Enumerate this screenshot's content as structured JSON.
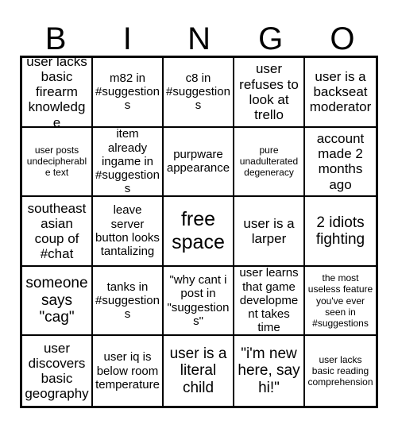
{
  "card": {
    "title_letters": [
      "B",
      "I",
      "N",
      "G",
      "O"
    ],
    "columns": 5,
    "rows": 5,
    "free_space_index": 12,
    "colors": {
      "background": "#ffffff",
      "text": "#000000",
      "grid_line": "#000000"
    },
    "cells": [
      {
        "text": "user lacks basic firearm knowledge",
        "size": "lg"
      },
      {
        "text": "m82 in #suggestions",
        "size": "md"
      },
      {
        "text": "c8 in #suggestions",
        "size": "md"
      },
      {
        "text": "user refuses to look at trello",
        "size": "lg"
      },
      {
        "text": "user is a backseat moderator",
        "size": "lg"
      },
      {
        "text": "user posts undecipherable text",
        "size": "sm"
      },
      {
        "text": "item already ingame in #suggestions",
        "size": "md"
      },
      {
        "text": "purpware appearance",
        "size": "md"
      },
      {
        "text": "pure unadulterated degeneracy",
        "size": "sm"
      },
      {
        "text": "account made 2 months ago",
        "size": "lg"
      },
      {
        "text": "southeast asian coup of #chat",
        "size": "lg"
      },
      {
        "text": "leave server button looks tantalizing",
        "size": "md"
      },
      {
        "text": "free space",
        "size": "xxl"
      },
      {
        "text": "user is a larper",
        "size": "lg"
      },
      {
        "text": "2 idiots fighting",
        "size": "xl"
      },
      {
        "text": "someone says \"cag\"",
        "size": "xl"
      },
      {
        "text": "tanks in #suggestions",
        "size": "md"
      },
      {
        "text": "\"why cant i post in \"suggestions\"",
        "size": "md"
      },
      {
        "text": "user learns that game development takes time",
        "size": "md"
      },
      {
        "text": "the most useless feature you've ever seen in #suggestions",
        "size": "sm"
      },
      {
        "text": "user discovers basic geography",
        "size": "lg"
      },
      {
        "text": "user iq is below room temperature",
        "size": "md"
      },
      {
        "text": "user is a literal child",
        "size": "xl"
      },
      {
        "text": "\"i'm new here, say hi!\"",
        "size": "xl"
      },
      {
        "text": "user lacks basic reading comprehension",
        "size": "sm"
      }
    ]
  }
}
